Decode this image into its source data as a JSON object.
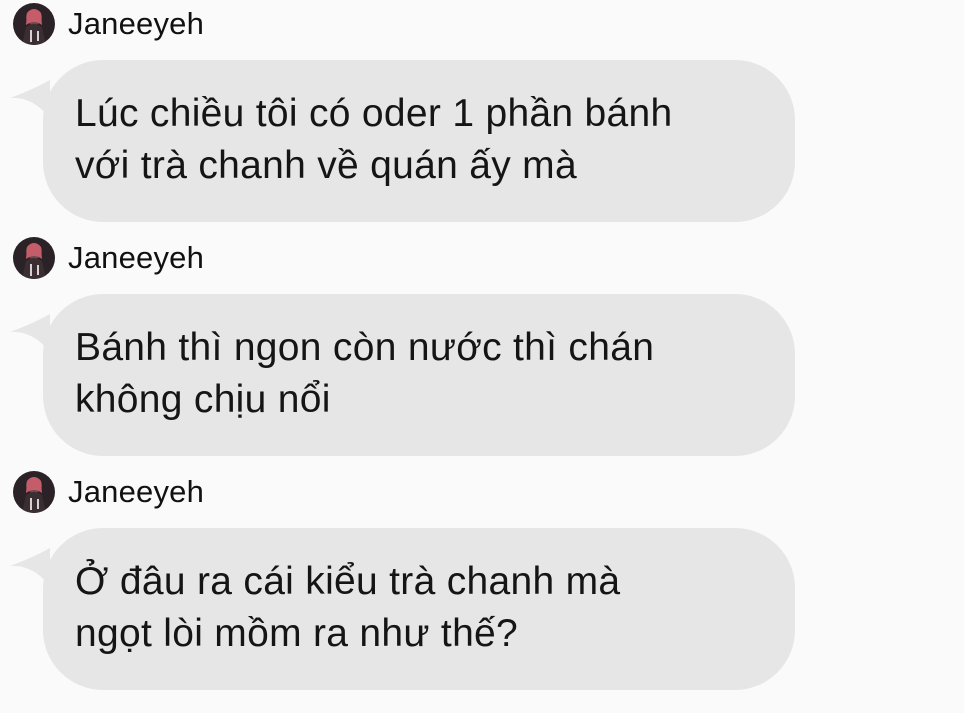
{
  "messages": [
    {
      "sender": "Janeeyeh",
      "lines": [
        "Lúc chiều tôi có oder 1 phần bánh",
        "với trà chanh về quán ấy mà"
      ]
    },
    {
      "sender": "Janeeyeh",
      "lines": [
        "Bánh thì ngon còn nước thì chán",
        "không chịu nổi"
      ]
    },
    {
      "sender": "Janeeyeh",
      "lines": [
        "Ở đâu ra cái kiểu trà chanh mà",
        "ngọt lòi mồm ra như thế?"
      ]
    }
  ],
  "colors": {
    "background": "#fafafa",
    "bubble": "#e6e6e6",
    "text": "#151515"
  },
  "icons": {
    "avatar": "profile-photo-avatar"
  }
}
